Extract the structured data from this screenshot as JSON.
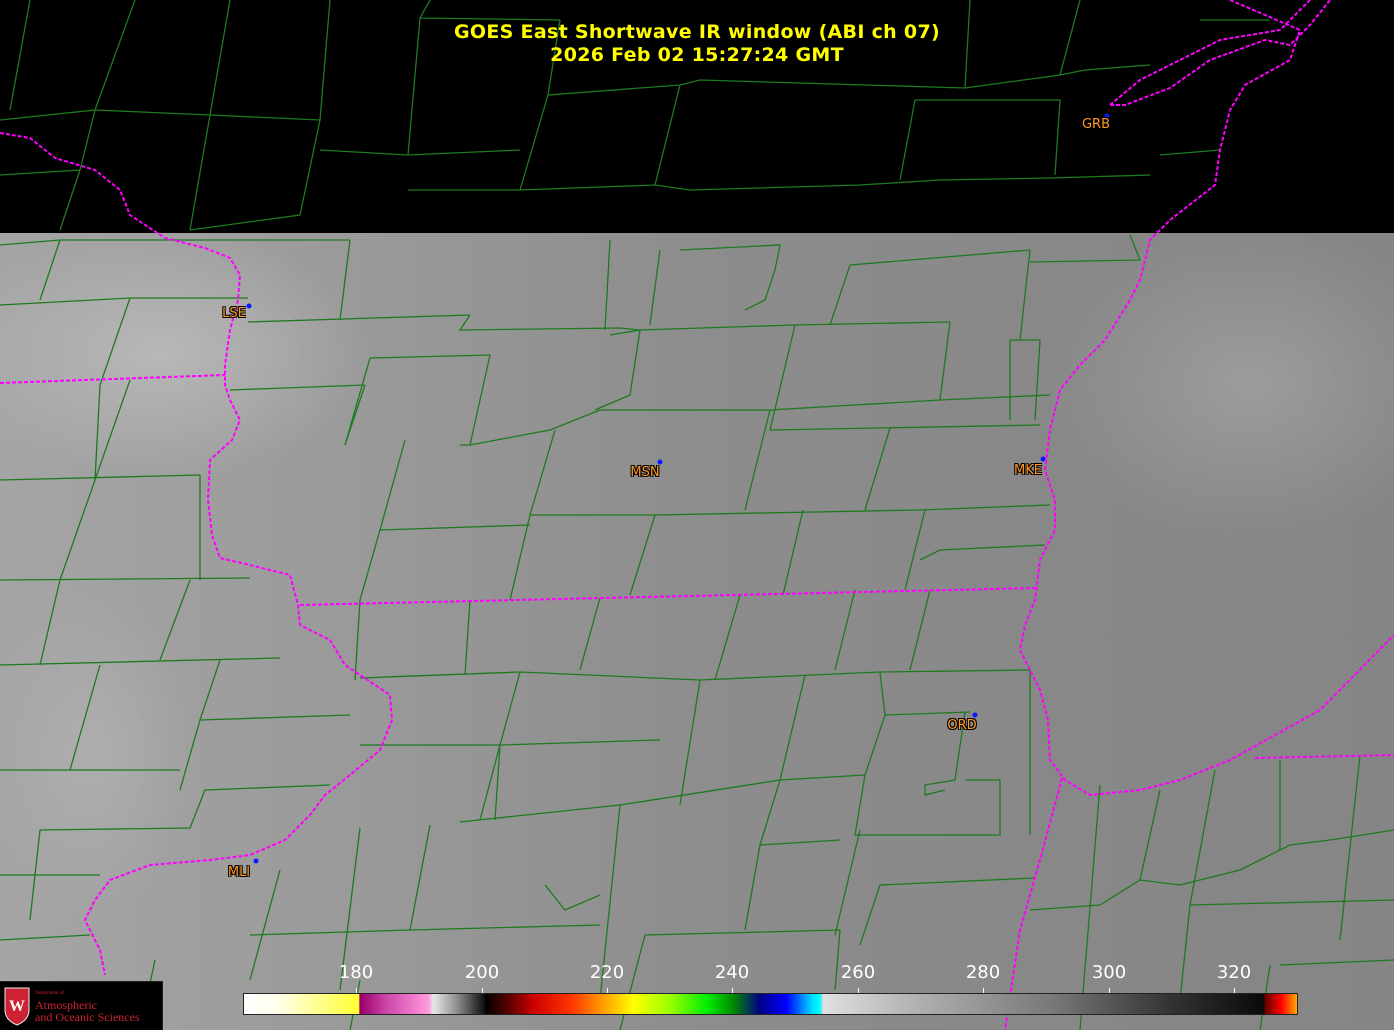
{
  "title": {
    "line1": "GOES East Shortwave IR window (ABI ch 07)",
    "line2": "2026 Feb 02  15:27:24 GMT"
  },
  "stations": [
    {
      "id": "GRB",
      "name": "GRB"
    },
    {
      "id": "LSE",
      "name": "LSE"
    },
    {
      "id": "MSN",
      "name": "MSN"
    },
    {
      "id": "MKE",
      "name": "MKE"
    },
    {
      "id": "ORD",
      "name": "ORD"
    },
    {
      "id": "MLI",
      "name": "MLI"
    }
  ],
  "colorbar": {
    "tick_labels": [
      "180",
      "200",
      "220",
      "240",
      "260",
      "280",
      "300",
      "320"
    ]
  },
  "logo": {
    "department_line": "Department of",
    "name_line1": "Atmospheric",
    "name_line2": "and Oceanic Sciences",
    "shield_letter": "W"
  },
  "colors": {
    "title": "#ffff00",
    "station_label": "#ff9922",
    "station_dot": "#0a1aff",
    "county_lines": "#1e7a1e",
    "state_borders": "#ff00ff",
    "logo_red": "#cc2233"
  }
}
